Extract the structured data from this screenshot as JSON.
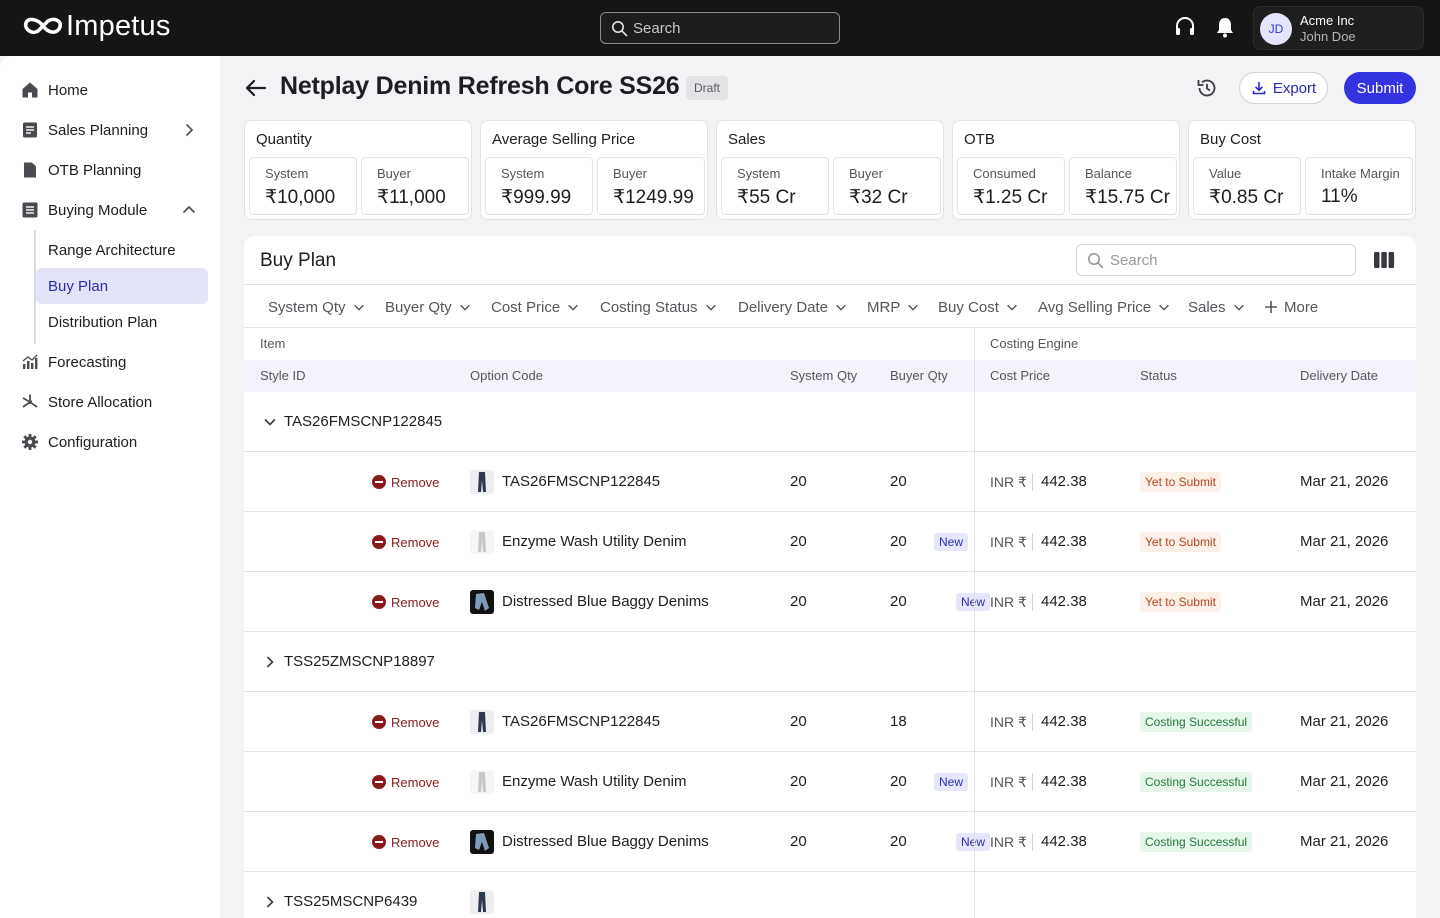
{
  "app": {
    "name": "Impetus"
  },
  "topbar": {
    "search_placeholder": "Search",
    "support_icon": "headset-icon",
    "notifications_icon": "bell-icon",
    "account": {
      "initials": "JD",
      "org": "Acme Inc",
      "user": "John Doe"
    }
  },
  "sidebar": {
    "items": [
      {
        "label": "Home",
        "icon": "home-icon"
      },
      {
        "label": "Sales Planning",
        "icon": "receipt-icon"
      },
      {
        "label": "OTB Planning",
        "icon": "document-icon"
      },
      {
        "label": "Buying Module",
        "icon": "list-icon"
      },
      {
        "label": "Forecasting",
        "icon": "chart-icon"
      },
      {
        "label": "Store Allocation",
        "icon": "network-icon"
      },
      {
        "label": "Configuration",
        "icon": "gear-icon"
      }
    ],
    "subitems": [
      {
        "label": "Range Architecture"
      },
      {
        "label": "Buy Plan",
        "active": true
      },
      {
        "label": "Distribution Plan"
      }
    ]
  },
  "header": {
    "title": "Netplay Denim Refresh Core SS26",
    "badge": "Draft",
    "export_label": "Export",
    "submit_label": "Submit"
  },
  "kpis": [
    {
      "title": "Quantity",
      "a_label": "System",
      "a_value": "₹10,000",
      "b_label": "Buyer",
      "b_value": "₹11,000"
    },
    {
      "title": "Average Selling Price",
      "a_label": "System",
      "a_value": "₹999.99",
      "b_label": "Buyer",
      "b_value": "₹1249.99"
    },
    {
      "title": "Sales",
      "a_label": "System",
      "a_value": "₹55 Cr",
      "b_label": "Buyer",
      "b_value": "₹32 Cr"
    },
    {
      "title": "OTB",
      "a_label": "Consumed",
      "a_value": "₹1.25 Cr",
      "b_label": "Balance",
      "b_value": "₹15.75 Cr"
    },
    {
      "title": "Buy Cost",
      "a_label": "Value",
      "a_value": "₹0.85 Cr",
      "b_label": "Intake Margin",
      "b_value": "11%"
    }
  ],
  "buyplan": {
    "title": "Buy Plan",
    "search_placeholder": "Search",
    "filters": [
      "System Qty",
      "Buyer Qty",
      "Cost Price",
      "Costing Status",
      "Delivery Date",
      "MRP",
      "Buy Cost",
      "Avg Selling Price",
      "Sales"
    ],
    "more_label": "More",
    "group_item": "Item",
    "group_costing": "Costing Engine",
    "columns": {
      "style_id": "Style ID",
      "option_code": "Option Code",
      "system_qty": "System Qty",
      "buyer_qty": "Buyer Qty",
      "cost_price": "Cost Price",
      "status": "Status",
      "delivery_date": "Delivery Date"
    },
    "remove_label": "Remove",
    "new_label": "New",
    "currency": "INR ₹",
    "groups": [
      {
        "style_id": "TAS26FMSCNP122845",
        "expanded": true
      },
      {
        "style_id": "TSS25ZMSCNP18897",
        "expanded": false
      },
      {
        "style_id": "TSS25MSCNP6439",
        "expanded": false
      }
    ],
    "rows": [
      {
        "option": "TAS26FMSCNP122845",
        "is_new": false,
        "system_qty": "20",
        "buyer_qty": "20",
        "cost": "442.38",
        "status": "Yet to Submit",
        "date": "Mar 21, 2026"
      },
      {
        "option": "Enzyme Wash Utility Denim",
        "is_new": true,
        "system_qty": "20",
        "buyer_qty": "20",
        "cost": "442.38",
        "status": "Yet to Submit",
        "date": "Mar 21, 2026"
      },
      {
        "option": "Distressed Blue Baggy Denims",
        "is_new": true,
        "system_qty": "20",
        "buyer_qty": "20",
        "cost": "442.38",
        "status": "Yet to Submit",
        "date": "Mar 21, 2026"
      },
      {
        "option": "TAS26FMSCNP122845",
        "is_new": false,
        "system_qty": "20",
        "buyer_qty": "18",
        "cost": "442.38",
        "status": "Costing Successful",
        "date": "Mar 21, 2026"
      },
      {
        "option": "Enzyme Wash Utility Denim",
        "is_new": true,
        "system_qty": "20",
        "buyer_qty": "20",
        "cost": "442.38",
        "status": "Costing Successful",
        "date": "Mar 21, 2026"
      },
      {
        "option": "Distressed Blue Baggy Denims",
        "is_new": true,
        "system_qty": "20",
        "buyer_qty": "20",
        "cost": "442.38",
        "status": "Costing Successful",
        "date": "Mar 21, 2026"
      }
    ]
  },
  "colors": {
    "accent": "#3333e0",
    "topbar": "#151515",
    "remove": "#8a1a1a"
  }
}
